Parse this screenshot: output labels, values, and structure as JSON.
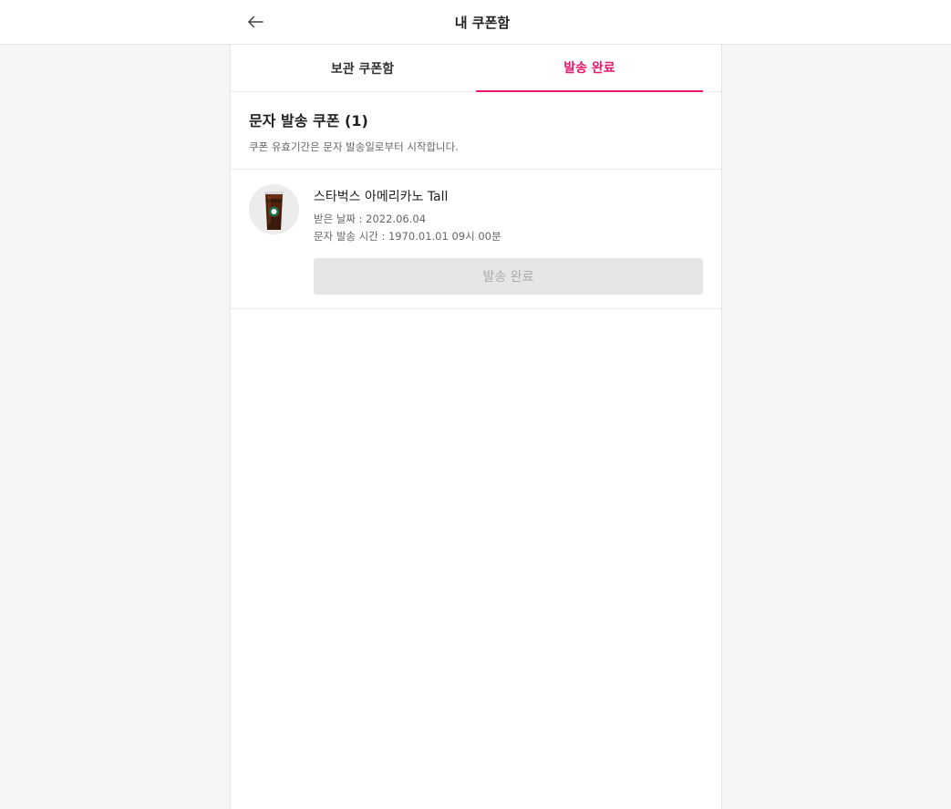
{
  "header": {
    "title": "내 쿠폰함",
    "back_icon": "arrow-left-icon"
  },
  "tabs": [
    {
      "label": "보관 쿠폰함",
      "active": false
    },
    {
      "label": "발송 완료",
      "active": true
    }
  ],
  "colors": {
    "accent": "#e5196e",
    "background": "#f5f5f5",
    "disabled_button": "#e6e6e6"
  },
  "section": {
    "title": "문자 발송 쿠폰 (1)",
    "description": "쿠폰 유효기간은 문자 발송일로부터 시작합니다."
  },
  "coupons": [
    {
      "name": "스타벅스 아메리카노 Tall",
      "received_date": "받은 날짜 : 2022.06.04",
      "sent_time": "문자 발송 시간 : 1970.01.01 09시 00분",
      "button_label": "발송 완료",
      "image_icon": "iced-americano-cup-icon"
    }
  ]
}
